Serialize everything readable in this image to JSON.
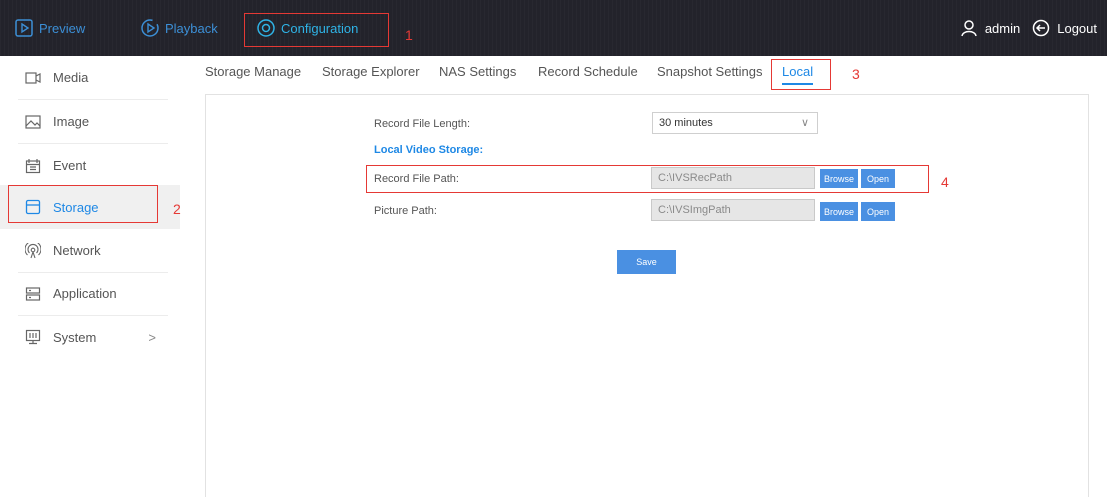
{
  "topnav": {
    "preview": "Preview",
    "playback": "Playback",
    "configuration": "Configuration",
    "user": "admin",
    "logout": "Logout"
  },
  "sidebar": {
    "items": [
      {
        "label": "Media",
        "icon": "media-icon"
      },
      {
        "label": "Image",
        "icon": "image-icon"
      },
      {
        "label": "Event",
        "icon": "event-icon"
      },
      {
        "label": "Storage",
        "icon": "storage-icon",
        "active": true
      },
      {
        "label": "Network",
        "icon": "network-icon"
      },
      {
        "label": "Application",
        "icon": "application-icon"
      },
      {
        "label": "System",
        "icon": "system-icon",
        "chevron": ">"
      }
    ]
  },
  "tabs": [
    "Storage Manage",
    "Storage Explorer",
    "NAS Settings",
    "Record Schedule",
    "Snapshot Settings",
    "Local"
  ],
  "form": {
    "record_file_length_label": "Record File Length:",
    "record_file_length_value": "30 minutes",
    "local_video_storage": "Local Video Storage:",
    "record_file_path_label": "Record File Path:",
    "record_file_path_value": "C:\\IVSRecPath",
    "picture_path_label": "Picture Path:",
    "picture_path_value": "C:\\IVSImgPath",
    "browse": "Browse",
    "open": "Open",
    "save": "Save"
  },
  "annotations": [
    "1",
    "2",
    "3",
    "4"
  ],
  "colors": {
    "topbar_bg": "#23232b",
    "accent": "#1e88e5",
    "button": "#4a90e2",
    "annotation": "#e53935"
  }
}
